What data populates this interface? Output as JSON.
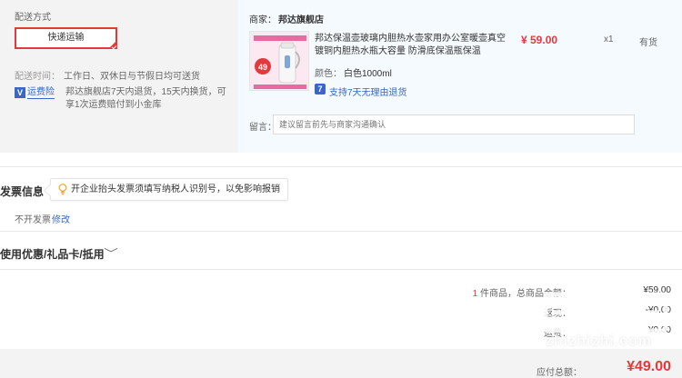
{
  "shipping": {
    "title": "配送方式",
    "option": "快递运输",
    "time_label": "配送时间：",
    "time_value": "工作日、双休日与节假日均可送货",
    "insurance_icon": "V",
    "insurance_label": "运费险",
    "insurance_desc": "邦达旗舰店7天内退货，15天内换货，可享1次运费赔付到小金库"
  },
  "item": {
    "shop_label": "商家：",
    "shop_name": "邦达旗舰店",
    "title": "邦达保温壶玻璃内胆热水壶家用办公室暖壶真空镀铜内胆热水瓶大容量 防滑底保温瓶保温",
    "price": "¥ 59.00",
    "quantity": "x1",
    "stock": "有货",
    "color_label": "颜色：",
    "color_value": "白色1000ml",
    "return_icon": "7",
    "return_label": "支持7天无理由退货",
    "memo_label": "留言：",
    "memo_placeholder": "建议留言前先与商家沟通确认",
    "image_icon": "thermos-product-image",
    "image_badge": "49"
  },
  "invoice": {
    "title": "发票信息",
    "tip": "开企业抬头发票须填写纳税人识别号，以免影响报销",
    "status": "不开发票",
    "edit": "修改"
  },
  "coupon": {
    "title": "使用优惠/礼品卡/抵用",
    "chevron": "﹀"
  },
  "summary": {
    "count": "1",
    "count_label": "件商品，总商品金额：",
    "total": "¥59.00",
    "line2_label": "返现：",
    "line2_value": "-¥0.00",
    "line3_label": "运费：",
    "line3_value": "¥0.00",
    "payable_label": "应付总额：",
    "payable_value": "¥49.00"
  },
  "watermark": "zhizhizhi.com",
  "colors": {
    "accent": "#e4393c",
    "link": "#3a66c4",
    "panel": "#f3f3f3",
    "item_panel": "#f4fafd"
  }
}
